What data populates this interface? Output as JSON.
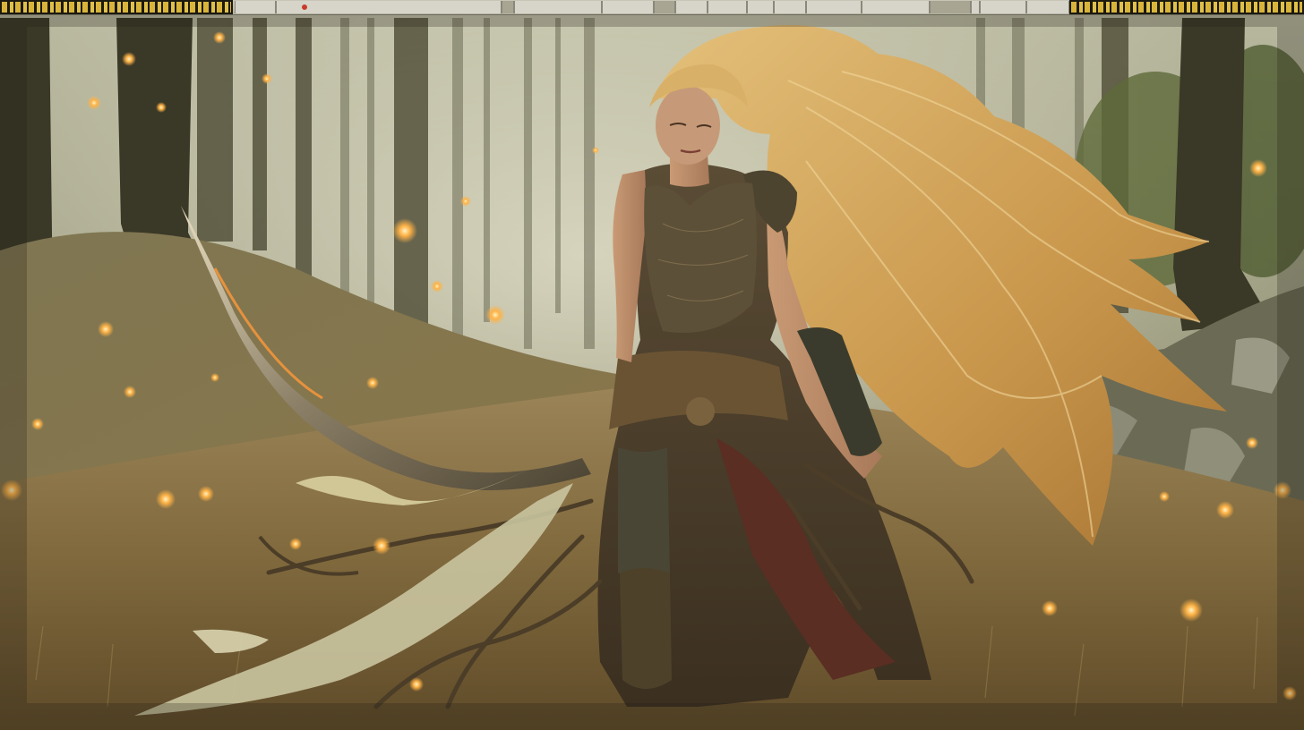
{
  "scene": {
    "subject": "warrior-woman",
    "setting": "misty-forest-meadow",
    "colors": {
      "fog": "#a8a78a",
      "grass": "#8a6f3c",
      "hair": "#d6a95a",
      "armor": "#5a4a32",
      "ember": "#ffb347"
    }
  },
  "top_strip": {
    "left_block": "striped-banner",
    "right_block": "striped-banner"
  }
}
